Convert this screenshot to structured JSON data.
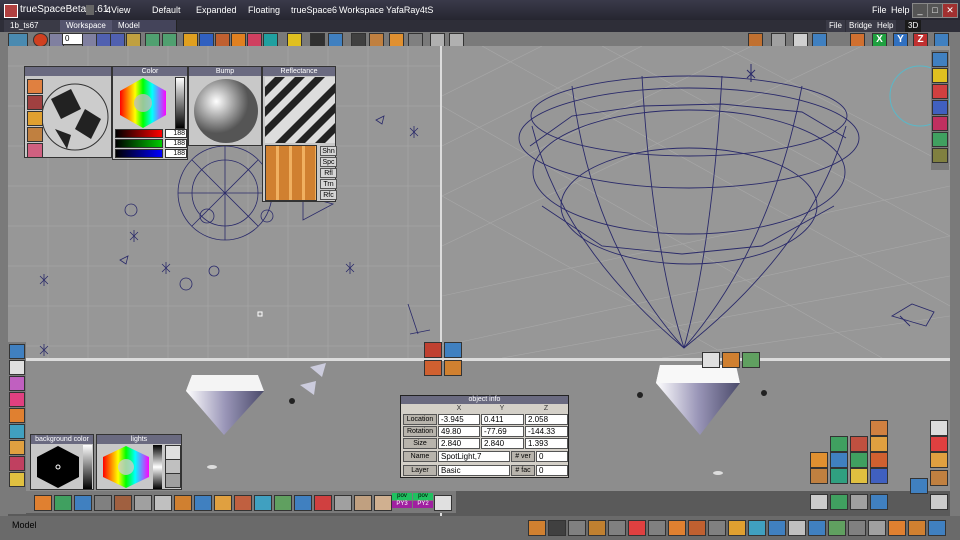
{
  "app": {
    "title": "trueSpaceBeta 7.61"
  },
  "top_tabs": [
    "4View",
    "Default",
    "Expanded",
    "Floating",
    "trueSpace6",
    "Workspace",
    "YafaRay4tS"
  ],
  "top_menu": {
    "file": "File",
    "help": "Help"
  },
  "window_buttons": {
    "minimize": "_",
    "maximize": "□",
    "close": "✕"
  },
  "doc_tabs": [
    "1b_ts67",
    "Workspace",
    "Model"
  ],
  "view_menu": [
    "File",
    "Bridge",
    "Help",
    "3D"
  ],
  "frame_counter": "0",
  "axis_buttons": [
    "X",
    "Y",
    "Z"
  ],
  "panels": {
    "color": {
      "title": "Color",
      "r": "188",
      "g": "188",
      "b": "188"
    },
    "bump": {
      "title": "Bump"
    },
    "reflectance": {
      "title": "Reflectance",
      "buttons": [
        "Shn",
        "Spc",
        "Rfl",
        "Trn",
        "Rfc"
      ]
    },
    "background_color": {
      "title": "background color"
    },
    "lights": {
      "title": "lights"
    }
  },
  "object_info": {
    "title": "object info",
    "col_headers": [
      "X",
      "Y",
      "Z"
    ],
    "location": {
      "label": "Location",
      "x": "-3.945",
      "y": "0.411",
      "z": "2.058"
    },
    "rotation": {
      "label": "Rotation",
      "x": "49.80",
      "y": "-77.69",
      "z": "-144.33"
    },
    "size": {
      "label": "Size",
      "x": "2.840",
      "y": "2.840",
      "z": "1.393"
    },
    "name": {
      "label": "Name",
      "value": "SpotLight,7",
      "ver_label": "# ver",
      "ver_value": "0"
    },
    "layer": {
      "label": "Layer",
      "value": "Basic",
      "fac_label": "# fac",
      "fac_value": "0"
    }
  },
  "pov_labels": [
    "pov",
    "PY3",
    "pov",
    "PY2"
  ],
  "status": {
    "mode": "Model"
  },
  "colors": {
    "viewport": "#979797",
    "wire": "#2a2a6a",
    "accent": "#6a6a80"
  }
}
